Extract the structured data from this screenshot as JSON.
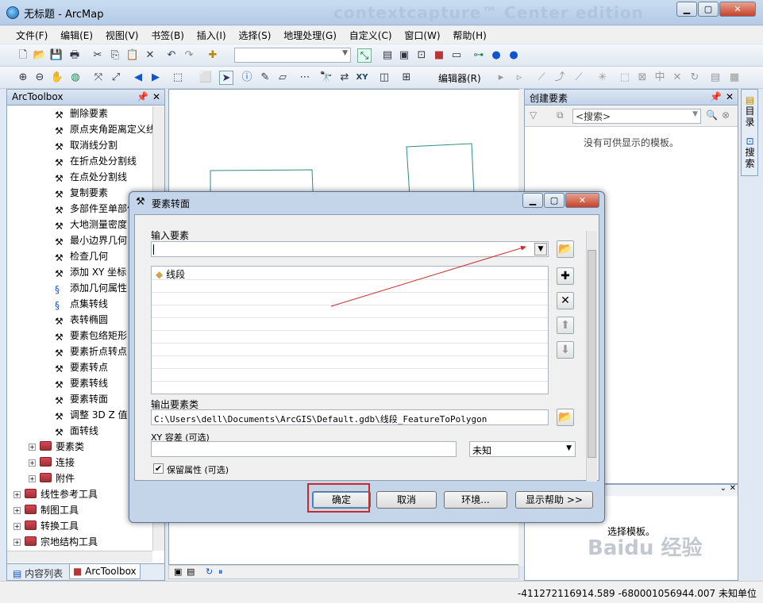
{
  "window": {
    "title": "无标题 - ArcMap",
    "watermark": "contextcapture™ Center edition"
  },
  "menu": [
    "文件(F)",
    "编辑(E)",
    "视图(V)",
    "书签(B)",
    "插入(I)",
    "选择(S)",
    "地理处理(G)",
    "自定义(C)",
    "窗口(W)",
    "帮助(H)"
  ],
  "toolbar": {
    "editor_label": "编辑器(R)"
  },
  "arctoolbox": {
    "title": "ArcToolbox",
    "tools": [
      "删除要素",
      "原点夹角距离定义线",
      "取消线分割",
      "在折点处分割线",
      "在点处分割线",
      "复制要素",
      "多部件至单部件",
      "大地测量密度",
      "最小边界几何",
      "检查几何",
      "添加 XY 坐标",
      "添加几何属性",
      "点集转线",
      "表转椭圆",
      "要素包络矩形",
      "要素折点转点",
      "要素转点",
      "要素转线",
      "要素转面",
      "调整 3D Z 值",
      "面转线"
    ],
    "toolsets": [
      "要素类",
      "连接",
      "附件"
    ],
    "toolboxes": [
      "线性参考工具",
      "制图工具",
      "转换工具",
      "宗地结构工具"
    ],
    "tabs": [
      "内容列表",
      "ArcToolbox"
    ]
  },
  "create_features": {
    "title": "创建要素",
    "search_placeholder": "<搜索>",
    "empty_message": "没有可供显示的模板。",
    "bottom_text": "选择模板。"
  },
  "side_tabs": [
    "目录",
    "搜索"
  ],
  "dialog": {
    "title": "要素转面",
    "input_label": "输入要素",
    "input_value": "",
    "list_items": [
      "线段"
    ],
    "output_label": "输出要素类",
    "output_value": "C:\\Users\\dell\\Documents\\ArcGIS\\Default.gdb\\线段_FeatureToPolygon",
    "xy_label": "XY 容差 (可选)",
    "xy_value": "",
    "unit_value": "未知",
    "keep_attr_label": "保留属性 (可选)",
    "keep_attr_checked": true,
    "buttons": {
      "ok": "确定",
      "cancel": "取消",
      "env": "环境...",
      "help": "显示帮助 >>"
    }
  },
  "status": {
    "coordinates": "-411272116914.589  -680001056944.007 未知单位"
  },
  "colors": {
    "accent_highlight": "#cc2a2a",
    "polygon_outline": "#2a8f80",
    "title_gradient": "#c9dcf1"
  }
}
